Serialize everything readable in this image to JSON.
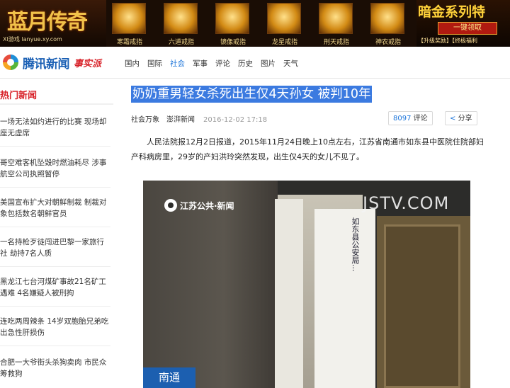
{
  "banner": {
    "logo_title": "蓝月传奇",
    "logo_site": "XI游戏 lanyue.xy.com",
    "slots": [
      "寒霜戒指",
      "六道戒指",
      "镜像戒指",
      "龙星戒指",
      "刑天戒指",
      "神农戒指"
    ],
    "promo_title": "暗金系列特",
    "promo_button": "一键领取",
    "promo_links": "【升级奖励】【终极福利"
  },
  "nav": {
    "brand": "腾讯新闻",
    "brand_sub": "事实派",
    "menu": [
      "国内",
      "国际",
      "社会",
      "军事",
      "评论",
      "历史",
      "图片",
      "天气"
    ],
    "active": "社会"
  },
  "sidebar": {
    "heading": "热门新闻",
    "items": [
      "一场无法如约进行的比赛 现场却座无虚席",
      "哥空难客机坠毁时燃油耗尽 涉事航空公司执照暂停",
      "美国宣布扩大对朝鲜制裁 制裁对象包括数名朝鲜官员",
      "一名持枪歹徒闯进巴黎一家旅行社 劫持7名人质",
      "黑龙江七台河煤矿事故21名矿工遇难 4名嫌疑人被刑拘",
      "连吃两周辣条 14岁双胞胎兄弟吃出急性肝损伤",
      "合肥一大爷街头杀狗卖肉 市民众筹救狗"
    ]
  },
  "article": {
    "title": "奶奶重男轻女杀死出生仅4天孙女 被判10年",
    "category": "社会万象",
    "source": "澎湃新闻",
    "time": "2016-12-02 17:18",
    "comment_count": "8097",
    "comment_label": "评论",
    "share_label": "分享",
    "paragraph": "人民法院报12月2日报道，2015年11月24日晚上10点左右，江苏省南通市如东县中医院住院部妇产科病房里，29岁的产妇洪玲突然发现，出生仅4天的女儿不见了。",
    "image": {
      "station_logo": "江苏公共·新闻",
      "watermark": "JSTV.COM",
      "location": "南通",
      "paper_text": "如东县公安局..."
    }
  },
  "colors": {
    "brand_blue": "#1a5fb4",
    "hot_red": "#d8232a",
    "title_highlight": "#3b7ae0",
    "active_link": "#1a73d9"
  }
}
